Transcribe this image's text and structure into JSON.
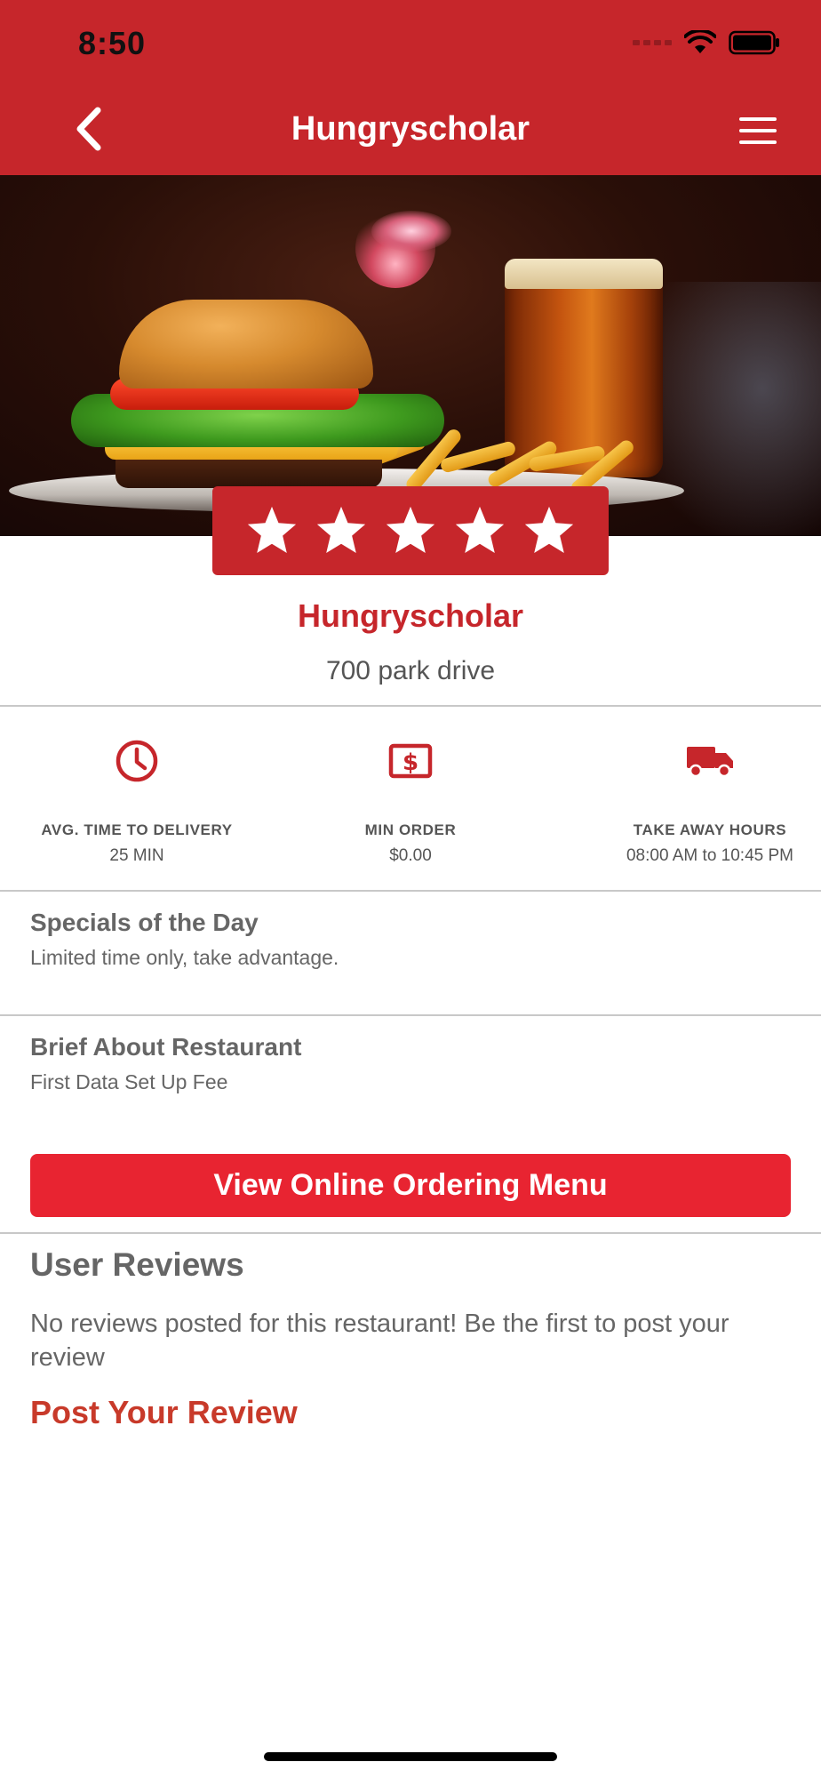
{
  "status_bar": {
    "time": "8:50"
  },
  "nav": {
    "title": "Hungryscholar",
    "back_icon": "chevron-left-icon",
    "menu_icon": "hamburger-menu-icon"
  },
  "rating": {
    "stars": 5,
    "max_stars": 5
  },
  "restaurant": {
    "name": "Hungryscholar",
    "address": "700 park drive"
  },
  "stats": [
    {
      "icon": "clock-icon",
      "label": "AVG. TIME TO DELIVERY",
      "value": "25 MIN"
    },
    {
      "icon": "dollar-bill-icon",
      "label": "MIN ORDER",
      "value": "$0.00"
    },
    {
      "icon": "delivery-truck-icon",
      "label": "TAKE AWAY HOURS",
      "value": "08:00 AM to 10:45 PM"
    }
  ],
  "specials": {
    "title": "Specials of the Day",
    "subtitle": "Limited time only, take advantage."
  },
  "brief": {
    "title": "Brief About Restaurant",
    "subtitle": "First Data Set Up Fee"
  },
  "order_button": {
    "label": "View Online Ordering Menu"
  },
  "reviews": {
    "title": "User Reviews",
    "empty_text": "No reviews posted for this restaurant! Be the first to post your review",
    "post_label": "Post Your Review"
  },
  "colors": {
    "brand_red": "#c6262b",
    "button_red": "#e82431",
    "link_red": "#c83a2a",
    "text_gray": "#666666"
  }
}
